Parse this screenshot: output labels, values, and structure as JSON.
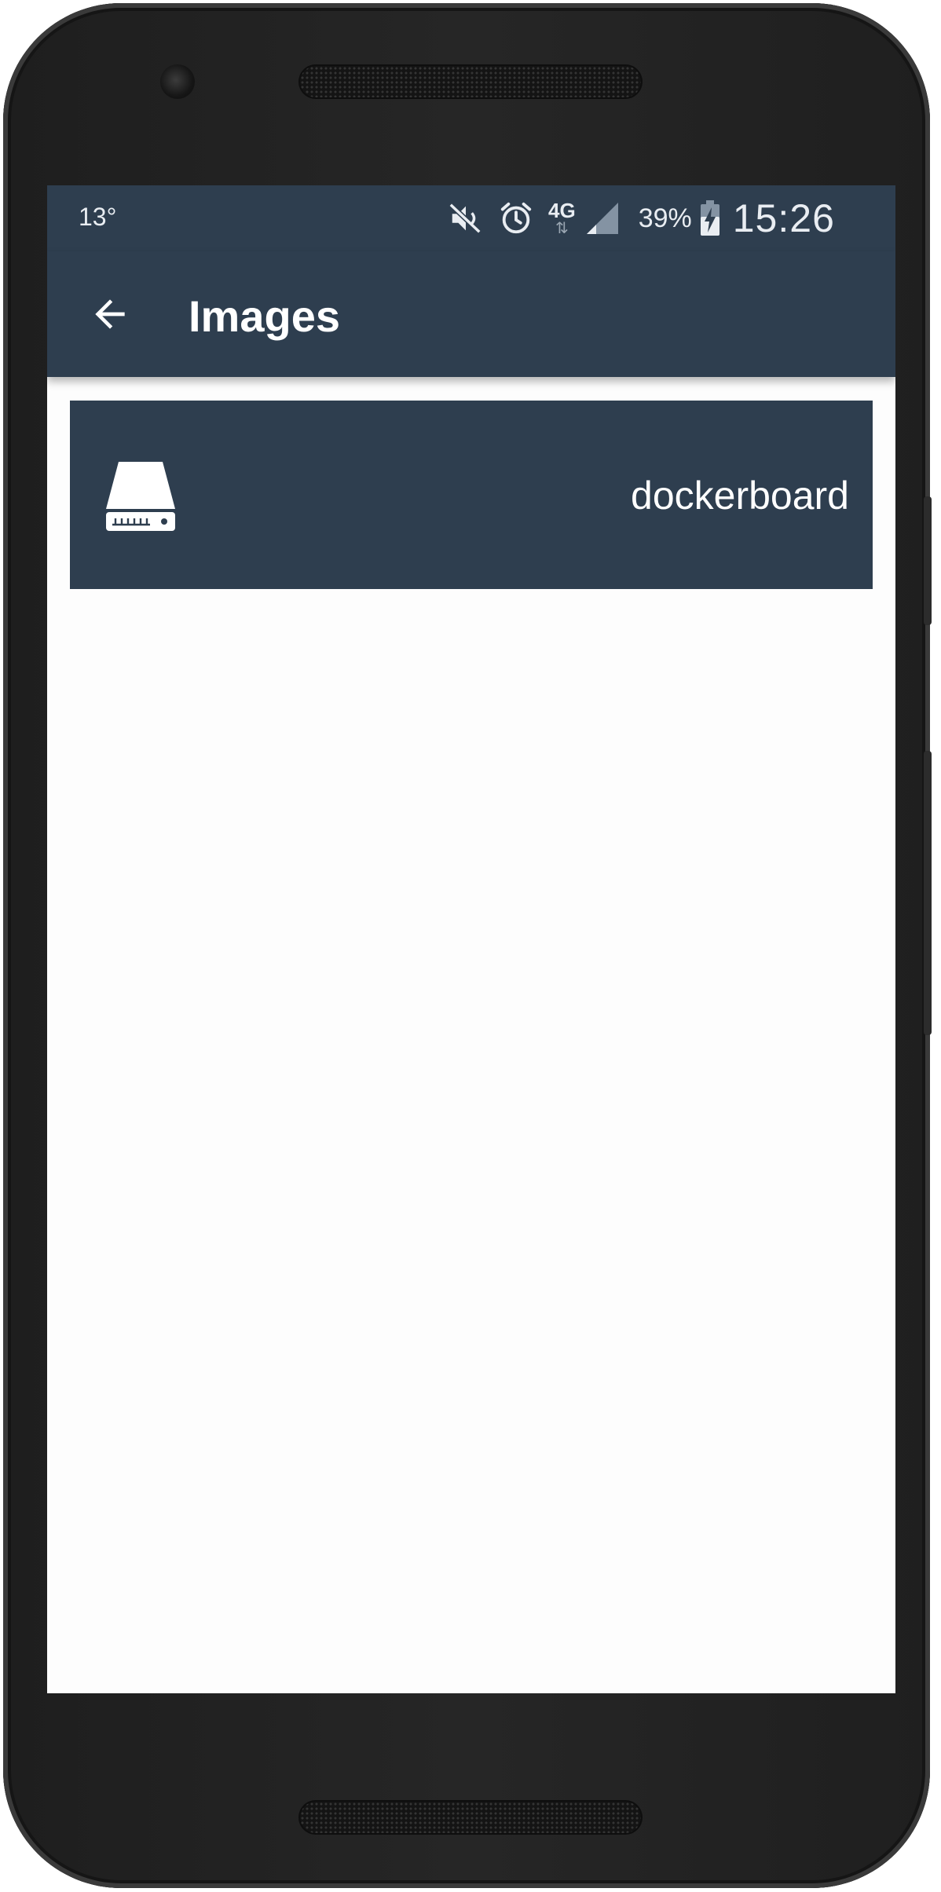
{
  "status_bar": {
    "temperature": "13°",
    "network_type": "4G",
    "network_arrows": "⇅",
    "battery_percent": "39%",
    "time": "15:26",
    "icons": [
      "mute-icon",
      "alarm-icon",
      "network-4g-icon",
      "signal-icon",
      "battery-charging-icon"
    ]
  },
  "app_bar": {
    "title": "Images",
    "back_icon": "arrow-back-icon"
  },
  "images": [
    {
      "name": "dockerboard",
      "icon": "hard-drive-icon"
    }
  ],
  "colors": {
    "primary": "#2e3e4f",
    "background": "#fdfdfd",
    "text_on_primary": "#ffffff"
  }
}
